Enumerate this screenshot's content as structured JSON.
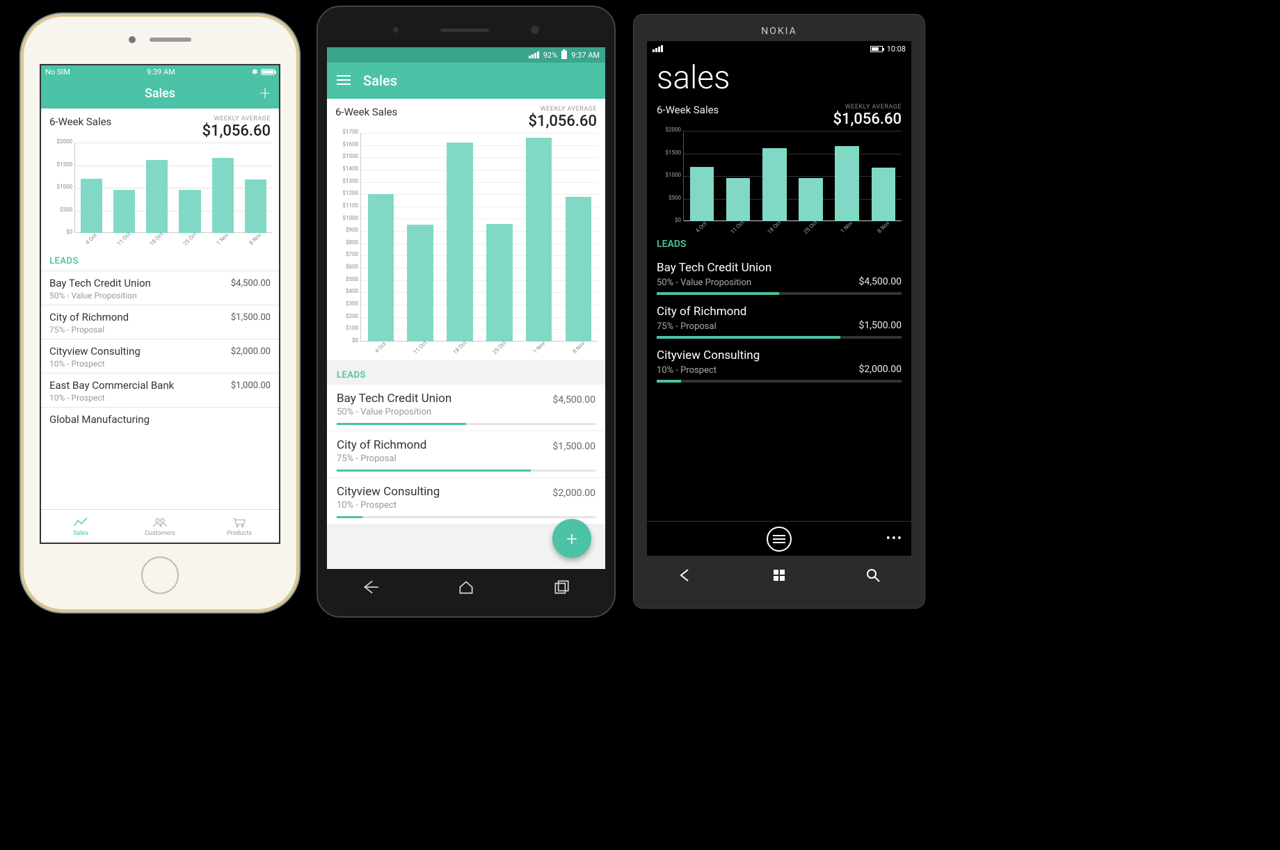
{
  "chart_data": {
    "type": "bar",
    "categories": [
      "4 Oct",
      "11 Oct",
      "18 Oct",
      "25 Oct",
      "1 Nov",
      "8 Nov"
    ],
    "values": [
      1200,
      950,
      1620,
      960,
      1660,
      1180
    ],
    "title": "6-Week Sales",
    "xlabel": "",
    "ylabel": "",
    "variants": {
      "ios": {
        "ylim": [
          0,
          2000
        ],
        "yticks": [
          2000,
          1500,
          1000,
          500,
          0
        ]
      },
      "android": {
        "ylim": [
          0,
          1700
        ],
        "yticks": [
          1700,
          1600,
          1500,
          1400,
          1300,
          1200,
          1100,
          1000,
          900,
          800,
          700,
          600,
          500,
          400,
          300,
          200,
          100,
          0
        ]
      },
      "wp": {
        "ylim": [
          0,
          2000
        ],
        "yticks": [
          2000,
          1500,
          1000,
          500,
          0
        ]
      }
    }
  },
  "weekly_average": {
    "label": "WEEKLY AVERAGE",
    "value": "$1,056.60"
  },
  "leads_header": "LEADS",
  "leads": [
    {
      "name": "Bay Tech Credit Union",
      "stage": "50% - Value Proposition",
      "amount": "$4,500.00",
      "pct": 50
    },
    {
      "name": "City of Richmond",
      "stage": "75% - Proposal",
      "amount": "$1,500.00",
      "pct": 75
    },
    {
      "name": "Cityview Consulting",
      "stage": "10% - Prospect",
      "amount": "$2,000.00",
      "pct": 10
    },
    {
      "name": "East Bay Commercial Bank",
      "stage": "10% - Prospect",
      "amount": "$1,000.00",
      "pct": 10
    },
    {
      "name": "Global Manufacturing",
      "stage": "",
      "amount": "",
      "pct": 0
    }
  ],
  "ios": {
    "status": {
      "left": "No SIM",
      "time": "9:39 AM"
    },
    "nav_title": "Sales",
    "tabs": [
      {
        "label": "Sales"
      },
      {
        "label": "Customers"
      },
      {
        "label": "Products"
      }
    ]
  },
  "android": {
    "status": {
      "battery": "92%",
      "time": "9:37 AM"
    },
    "nav_title": "Sales"
  },
  "wp": {
    "brand": "NOKIA",
    "status_time": "10:08",
    "title": "sales"
  }
}
